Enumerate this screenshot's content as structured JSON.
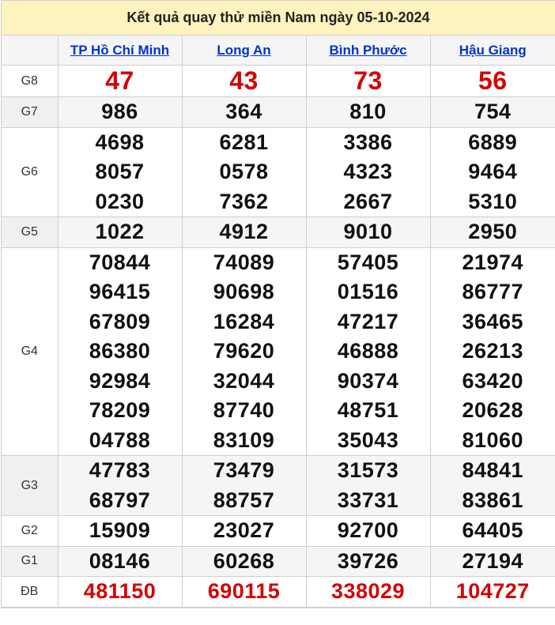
{
  "title": "Kết quả quay thử miền Nam ngày 05-10-2024",
  "provinces": [
    "TP Hồ Chí Minh",
    "Long An",
    "Bình Phước",
    "Hậu Giang"
  ],
  "rows": [
    {
      "label": "G8",
      "values": [
        [
          "47"
        ],
        [
          "43"
        ],
        [
          "73"
        ],
        [
          "56"
        ]
      ]
    },
    {
      "label": "G7",
      "values": [
        [
          "986"
        ],
        [
          "364"
        ],
        [
          "810"
        ],
        [
          "754"
        ]
      ]
    },
    {
      "label": "G6",
      "values": [
        [
          "4698",
          "8057",
          "0230"
        ],
        [
          "6281",
          "0578",
          "7362"
        ],
        [
          "3386",
          "4323",
          "2667"
        ],
        [
          "6889",
          "9464",
          "5310"
        ]
      ]
    },
    {
      "label": "G5",
      "values": [
        [
          "1022"
        ],
        [
          "4912"
        ],
        [
          "9010"
        ],
        [
          "2950"
        ]
      ]
    },
    {
      "label": "G4",
      "values": [
        [
          "70844",
          "96415",
          "67809",
          "86380",
          "92984",
          "78209",
          "04788"
        ],
        [
          "74089",
          "90698",
          "16284",
          "79620",
          "32044",
          "87740",
          "83109"
        ],
        [
          "57405",
          "01516",
          "47217",
          "46888",
          "90374",
          "48751",
          "35043"
        ],
        [
          "21974",
          "86777",
          "36465",
          "26213",
          "63420",
          "20628",
          "81060"
        ]
      ]
    },
    {
      "label": "G3",
      "values": [
        [
          "47783",
          "68797"
        ],
        [
          "73479",
          "88757"
        ],
        [
          "31573",
          "33731"
        ],
        [
          "84841",
          "83861"
        ]
      ]
    },
    {
      "label": "G2",
      "values": [
        [
          "15909"
        ],
        [
          "23027"
        ],
        [
          "92700"
        ],
        [
          "64405"
        ]
      ]
    },
    {
      "label": "G1",
      "values": [
        [
          "08146"
        ],
        [
          "60268"
        ],
        [
          "39726"
        ],
        [
          "27194"
        ]
      ]
    },
    {
      "label": "ĐB",
      "values": [
        [
          "481150"
        ],
        [
          "690115"
        ],
        [
          "338029"
        ],
        [
          "104727"
        ]
      ]
    }
  ]
}
